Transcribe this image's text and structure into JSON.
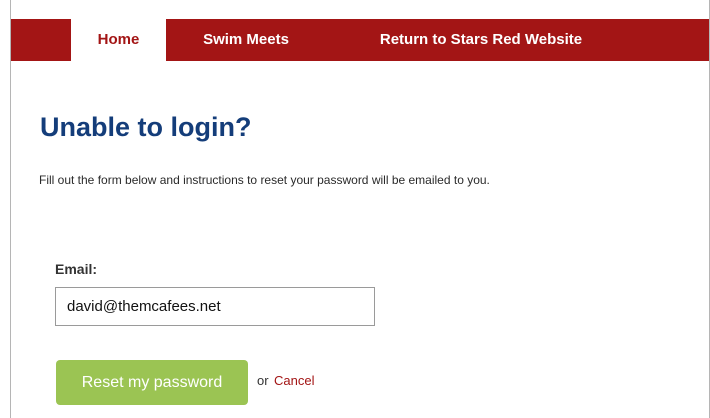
{
  "nav": {
    "items": [
      {
        "label": "Home",
        "active": true
      },
      {
        "label": "Swim Meets",
        "active": false
      },
      {
        "label": "Return to Stars Red Website",
        "active": false
      }
    ]
  },
  "page": {
    "title": "Unable to login?",
    "intro": "Fill out the form below and instructions to reset your password will be emailed to you."
  },
  "form": {
    "email_label": "Email:",
    "email_value": "david@themcafees.net",
    "reset_button": "Reset my password",
    "or_text": "or",
    "cancel_link": "Cancel"
  },
  "colors": {
    "nav_background": "#a31515",
    "title": "#143d7a",
    "button": "#9bc453",
    "link": "#a31515"
  }
}
